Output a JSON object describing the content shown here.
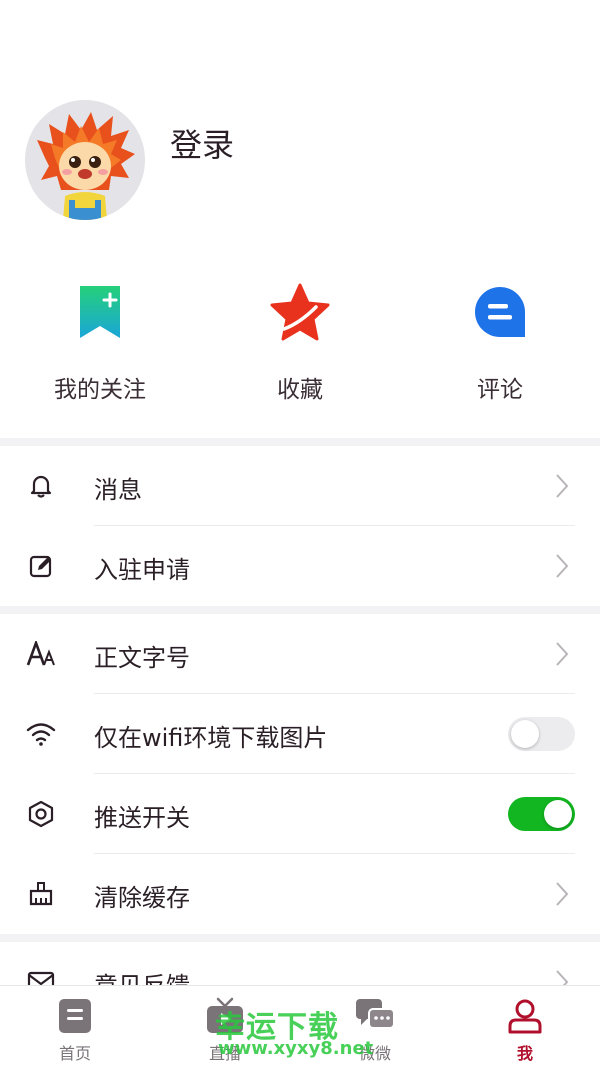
{
  "profile": {
    "login_label": "登录"
  },
  "quick_actions": [
    {
      "label": "我的关注",
      "icon": "bookmark-plus-icon",
      "color": "#1fc48a"
    },
    {
      "label": "收藏",
      "icon": "star-icon",
      "color": "#e8321e"
    },
    {
      "label": "评论",
      "icon": "comment-icon",
      "color": "#1f73e8"
    }
  ],
  "menu": {
    "messages": "消息",
    "apply": "入驻申请",
    "font_size": "正文字号",
    "wifi_images": "仅在wifi环境下载图片",
    "push": "推送开关",
    "clear_cache": "清除缓存",
    "feedback": "意见反馈"
  },
  "toggles": {
    "wifi_images": false,
    "push": true
  },
  "tabs": [
    {
      "label": "首页"
    },
    {
      "label": "直播"
    },
    {
      "label": "微微"
    },
    {
      "label": "我"
    }
  ],
  "watermark": {
    "text": "幸运下载",
    "url": "www.xyxy8.net"
  },
  "colors": {
    "accent": "#b0102c",
    "toggle_on": "#12b620"
  }
}
